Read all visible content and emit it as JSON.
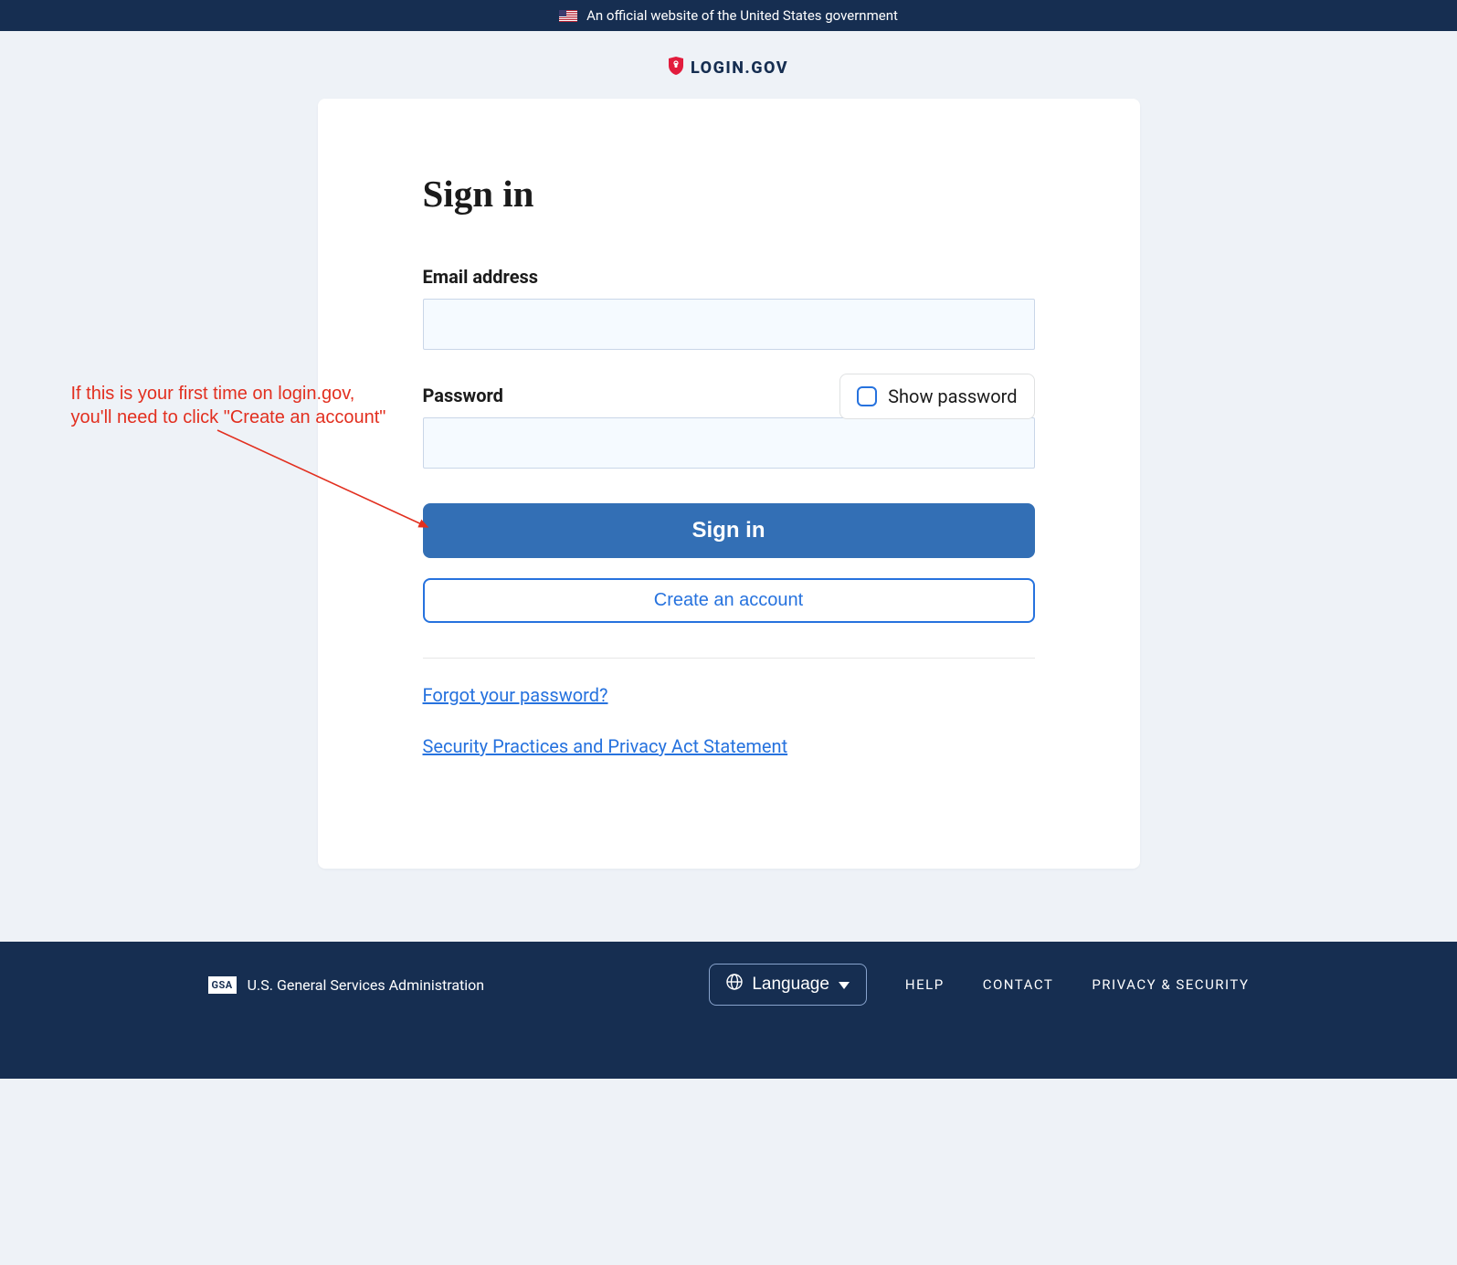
{
  "banner": {
    "text": "An official website of the United States government"
  },
  "logo": {
    "text": "LOGIN.GOV"
  },
  "form": {
    "title": "Sign in",
    "email_label": "Email address",
    "password_label": "Password",
    "show_password_label": "Show password",
    "signin_button": "Sign in",
    "create_account_button": "Create an account",
    "forgot_password_link": "Forgot your password?",
    "security_link": "Security Practices and Privacy Act Statement"
  },
  "annotation": {
    "line1": "If this is your first time on login.gov,",
    "line2": "you'll need to click \"Create an account\""
  },
  "footer": {
    "gsa_badge": "GSA",
    "agency": "U.S. General Services Administration",
    "language_label": "Language",
    "links": {
      "help": "HELP",
      "contact": "CONTACT",
      "privacy": "PRIVACY & SECURITY"
    }
  }
}
